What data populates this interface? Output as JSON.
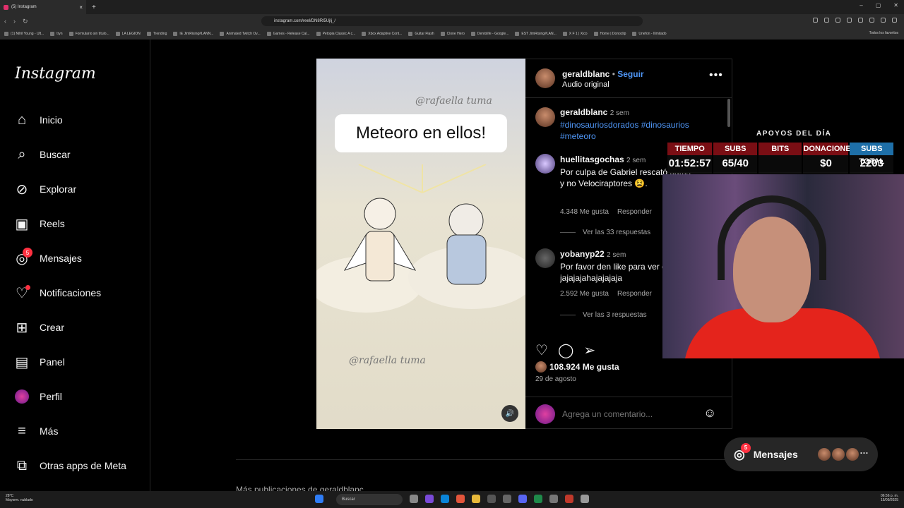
{
  "browser": {
    "tab_title": "(5) Instagram",
    "url": "instagram.com/reel/DN8Rl5Ujlj_/",
    "bookmarks": [
      "(1) Nihil Young - Ult...",
      "tryn",
      "Formulario sin título...",
      "LA LEGION",
      "Trending",
      "IE JimRising#LANN...",
      "Animated Twitch Ov...",
      "Games - Release Cal...",
      "Petopia Classic A c...",
      "Xbox Adaptive Cont...",
      "Guitar Flash",
      "Clone Hero",
      "Dentolife - Google...",
      "EST JimRising#LAN...",
      "X F 1 | Xico",
      "Home | Donoclip",
      "Unefon - Ilimitado"
    ],
    "bookmarks_right": "Todos los favoritos"
  },
  "sidebar": {
    "logo": "Instagram",
    "items": [
      {
        "label": "Inicio",
        "icon": "home-icon"
      },
      {
        "label": "Buscar",
        "icon": "search-icon"
      },
      {
        "label": "Explorar",
        "icon": "compass-icon"
      },
      {
        "label": "Reels",
        "icon": "reels-icon"
      },
      {
        "label": "Mensajes",
        "icon": "messenger-icon",
        "badge": "5"
      },
      {
        "label": "Notificaciones",
        "icon": "heart-icon"
      },
      {
        "label": "Crear",
        "icon": "plus-icon"
      },
      {
        "label": "Panel",
        "icon": "dashboard-icon"
      },
      {
        "label": "Perfil",
        "icon": "avatar-icon"
      },
      {
        "label": "Más",
        "icon": "menu-icon"
      },
      {
        "label": "Otras apps de Meta",
        "icon": "apps-icon"
      }
    ]
  },
  "reel": {
    "caption_box": "Meteoro en ellos!",
    "watermark": "@rafaella tuma"
  },
  "post": {
    "author": "geraldblanc",
    "follow": "Seguir",
    "audio": "Audio original",
    "caption_time": "2 sem",
    "caption_tags": "#dinosauriosdorados #dinosaurios #meteoro",
    "comments": [
      {
        "user": "huellitasgochas",
        "time": "2 sem",
        "text": "Por culpa de Gabriel rescató gatos y no Velociraptores 😫.",
        "likes": "4.348 Me gusta",
        "reply": "Responder",
        "view_replies": "Ver las 33 respuestas"
      },
      {
        "user": "yobanyp22",
        "time": "2 sem",
        "text": "Por favor den like para ver esto jajajajahajajajaja",
        "likes": "2.592 Me gusta",
        "reply": "Responder",
        "view_replies": "Ver las 3 respuestas"
      }
    ],
    "like_count": "108.924 Me gusta",
    "date": "29 de agosto",
    "comment_placeholder": "Agrega un comentario..."
  },
  "stream_overlay": {
    "title": "APOYOS DEL DÍA",
    "cells": [
      {
        "label": "TIEMPO",
        "value": "01:52:57"
      },
      {
        "label": "SUBS",
        "value": "65/40"
      },
      {
        "label": "BITS",
        "value": ""
      },
      {
        "label": "DONACIONES",
        "value": "$0"
      },
      {
        "label": "SUBS TOTAL",
        "value": "2203"
      }
    ]
  },
  "floating_messages": {
    "label": "Mensajes",
    "badge": "5"
  },
  "more_posts": "Más publicaciones de geraldblanc",
  "taskbar": {
    "weather_temp": "28°C",
    "weather_desc": "Mayorm. nublado",
    "search": "Buscar",
    "time": "06:56 p. m.",
    "date": "15/09/2025"
  },
  "colors": {
    "accent_blue": "#4f96f6",
    "badge_red": "#ff3040",
    "overlay_red": "#7a0e14"
  }
}
